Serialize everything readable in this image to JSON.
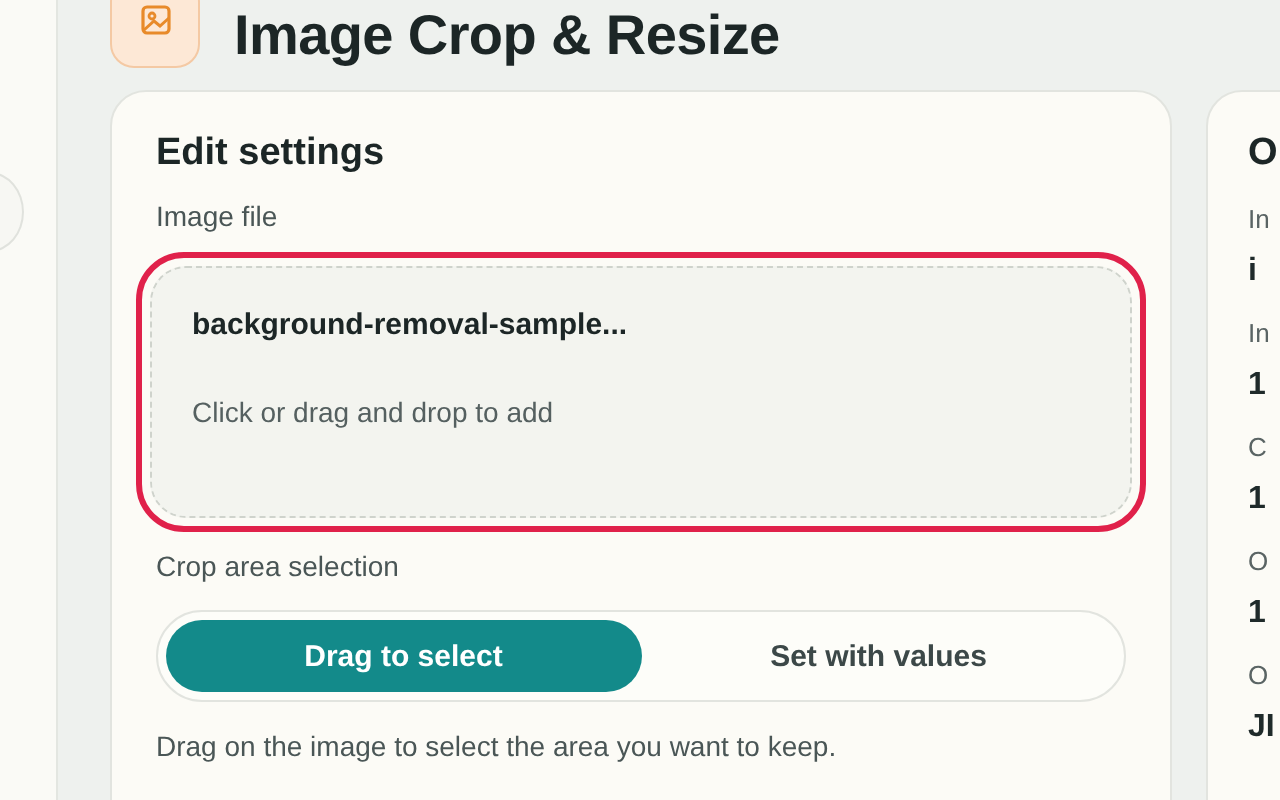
{
  "page_title": "Image Crop & Resize",
  "edit_card": {
    "title": "Edit settings",
    "file_label": "Image file",
    "file_drop": {
      "highlighted": true,
      "file_name": "background-removal-sample...",
      "hint": "Click or drag and drop to add"
    },
    "crop_label": "Crop area selection",
    "crop_modes": [
      {
        "label": "Drag to select",
        "selected": true
      },
      {
        "label": "Set with values",
        "selected": false
      }
    ],
    "crop_help": "Drag on the image to select the area you want to keep."
  },
  "side_card": {
    "title": "O",
    "fields": [
      {
        "label": "In",
        "value": "i"
      },
      {
        "label": "In",
        "value": "1"
      },
      {
        "label": "C",
        "value": "1"
      },
      {
        "label": "O",
        "value": "1"
      },
      {
        "label": "O",
        "value": "JI"
      }
    ]
  }
}
